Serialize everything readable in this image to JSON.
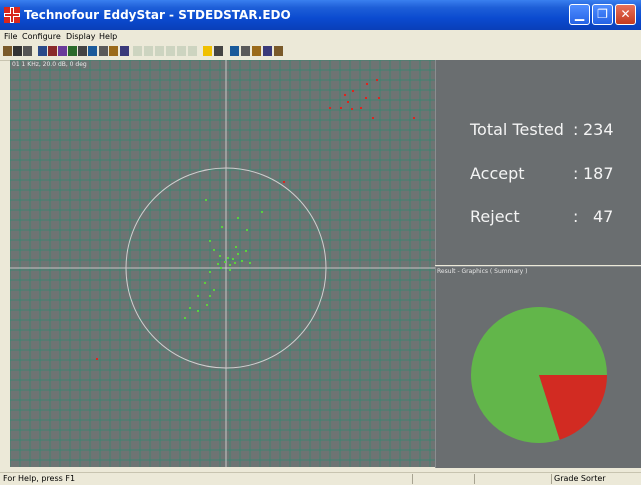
{
  "window": {
    "title": "Technofour EddyStar - STDEDSTAR.EDO",
    "controls": [
      "minimize",
      "maximize",
      "close"
    ]
  },
  "menu": [
    "File",
    "Configure",
    "Display",
    "Help"
  ],
  "toolbar": {
    "icons": [
      "open-icon",
      "print-icon",
      "print-setup-icon",
      "probe-icon",
      "scope-icon",
      "chart-icon",
      "fork-icon",
      "settings-icon",
      "table-icon",
      "report-icon",
      "tools-icon",
      "link-icon",
      "grid1-icon",
      "grid2-icon",
      "grid3-icon",
      "grid4-icon",
      "grid5-icon",
      "grid6-icon",
      "cursor-icon",
      "display-icon",
      "pen-icon",
      "balance-icon",
      "filter-icon",
      "speaker-icon",
      "wave-icon"
    ]
  },
  "plot": {
    "label": "01 1 KHz, 20.0 dB, 0 deg",
    "colors": {
      "background": "#6e7473",
      "grid": "#2f8a70",
      "axis": "#e0e0e0",
      "circle": "#c9c9c9",
      "accept_point": "#5bd23c",
      "reject_point": "#e0241c"
    },
    "red_points": [
      [
        377,
        80
      ],
      [
        367,
        84
      ],
      [
        353,
        91
      ],
      [
        345,
        95
      ],
      [
        379,
        98
      ],
      [
        366,
        98
      ],
      [
        348,
        102
      ],
      [
        341,
        108
      ],
      [
        330,
        108
      ],
      [
        352,
        109
      ],
      [
        361,
        108
      ],
      [
        373,
        118
      ],
      [
        414,
        118
      ],
      [
        284,
        182
      ],
      [
        97,
        359
      ]
    ],
    "green_points": [
      [
        238,
        218
      ],
      [
        247,
        230
      ],
      [
        210,
        241
      ],
      [
        236,
        247
      ],
      [
        214,
        250
      ],
      [
        246,
        251
      ],
      [
        238,
        254
      ],
      [
        220,
        256
      ],
      [
        228,
        258
      ],
      [
        233,
        259
      ],
      [
        242,
        261
      ],
      [
        225,
        262
      ],
      [
        218,
        264
      ],
      [
        230,
        265
      ],
      [
        235,
        263
      ],
      [
        250,
        263
      ],
      [
        221,
        268
      ],
      [
        210,
        272
      ],
      [
        230,
        270
      ],
      [
        205,
        283
      ],
      [
        214,
        290
      ],
      [
        198,
        296
      ],
      [
        210,
        296
      ],
      [
        207,
        305
      ],
      [
        190,
        308
      ],
      [
        198,
        311
      ],
      [
        185,
        318
      ],
      [
        206,
        200
      ],
      [
        262,
        212
      ],
      [
        222,
        227
      ]
    ]
  },
  "stats": {
    "total_label": "Total Tested",
    "total_value": "234",
    "accept_label": "Accept",
    "accept_value": "187",
    "reject_label": "Reject",
    "reject_value": "47"
  },
  "summary": {
    "title": "Result - Graphics ( Summary )",
    "slices": [
      {
        "label": "Accept",
        "value": 187,
        "color": "#62b64a"
      },
      {
        "label": "Reject",
        "value": 47,
        "color": "#d22b22"
      }
    ]
  },
  "status": {
    "help": "For Help, press F1",
    "mode": "Grade Sorter"
  }
}
